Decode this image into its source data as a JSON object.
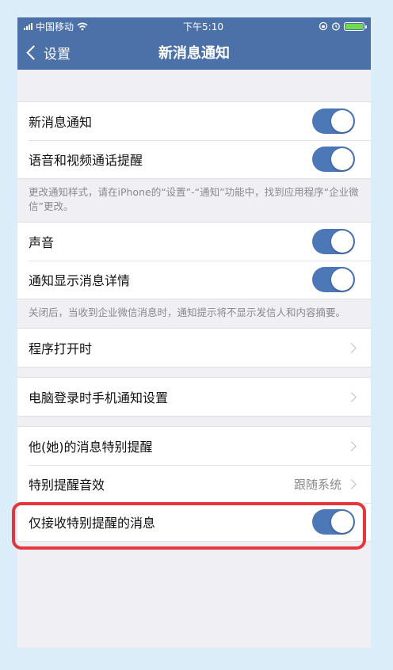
{
  "status_bar": {
    "carrier": "中国移动",
    "time": "下午5:10"
  },
  "nav": {
    "back_label": "设置",
    "title": "新消息通知"
  },
  "group1": {
    "items": [
      {
        "label": "新消息通知",
        "on": true
      },
      {
        "label": "语音和视频通话提醒",
        "on": true
      }
    ],
    "note": "更改通知样式，请在iPhone的“设置”-“通知”功能中，找到应用程序“企业微信”更改。"
  },
  "group2": {
    "items": [
      {
        "label": "声音",
        "on": true
      },
      {
        "label": "通知显示消息详情",
        "on": true
      }
    ],
    "note": "关闭后，当收到企业微信消息时，通知提示将不显示发信人和内容摘要。"
  },
  "group3": {
    "item": "程序打开时"
  },
  "group4": {
    "item": "电脑登录时手机通知设置"
  },
  "group5": {
    "items": [
      {
        "label": "他(她)的消息特别提醒"
      },
      {
        "label": "特别提醒音效",
        "value": "跟随系统"
      },
      {
        "label": "仅接收特别提醒的消息",
        "on": true
      }
    ]
  },
  "colors": {
    "nav_bg": "#4c70a8",
    "toggle_on": "#4c78b8",
    "highlight": "#e5353d"
  }
}
